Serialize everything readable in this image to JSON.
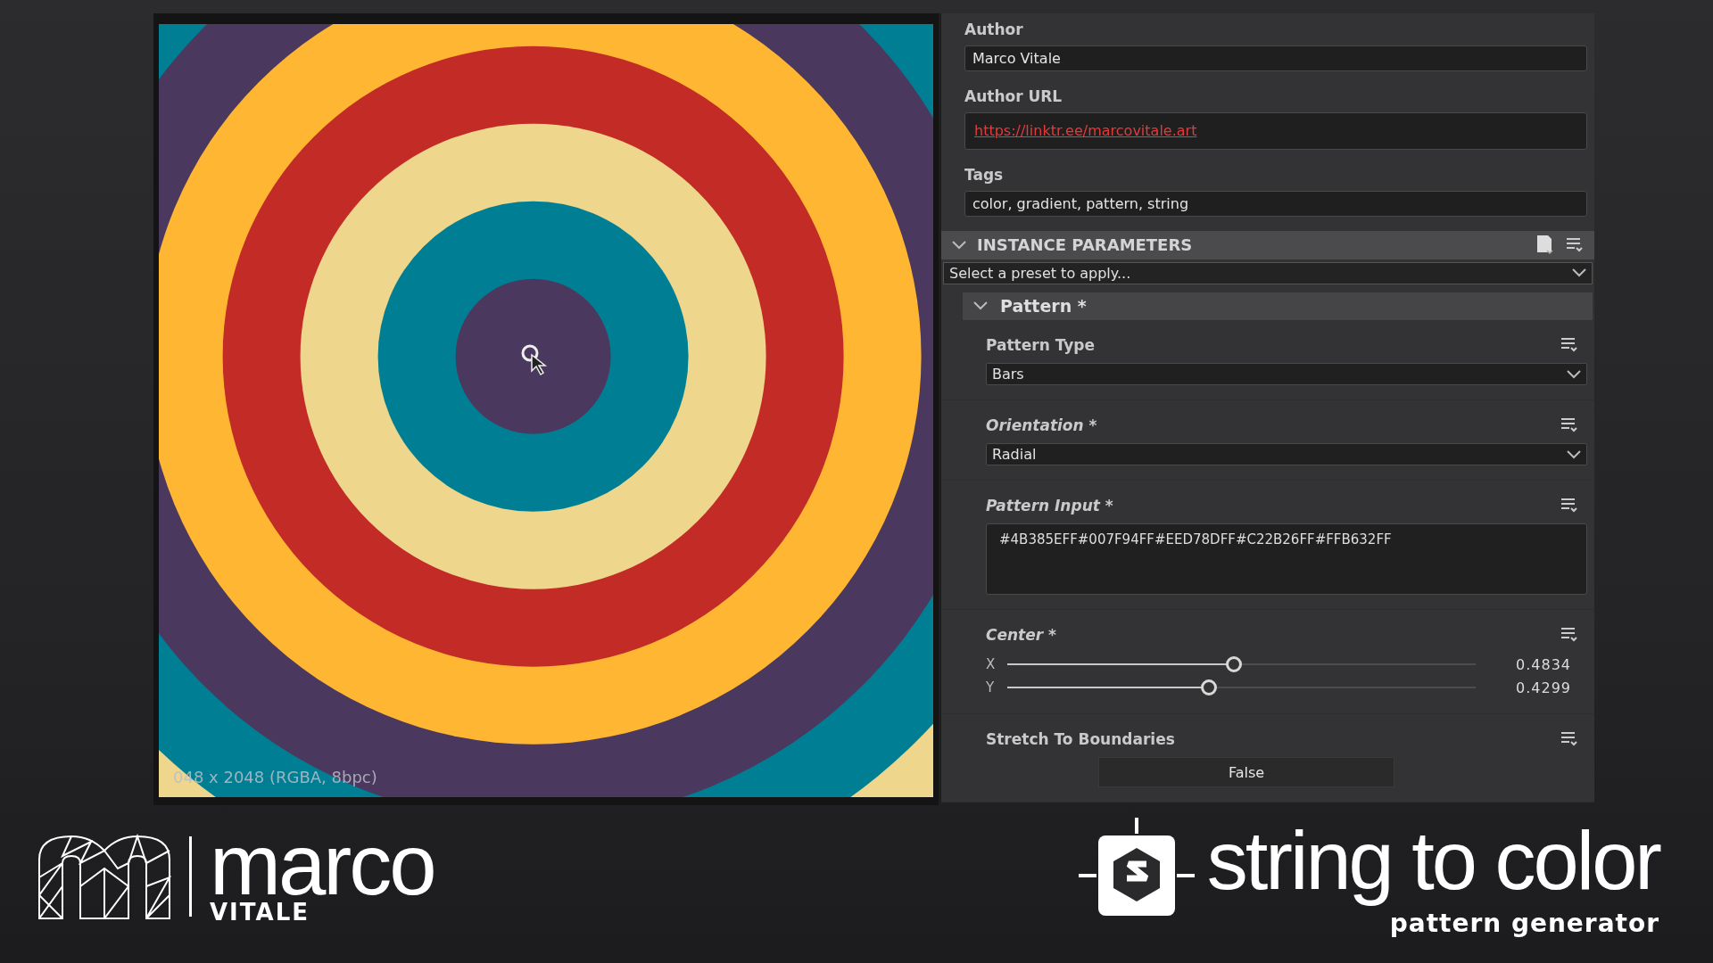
{
  "viewport": {
    "resolution_label": "048 x 2048 (RGBA, 8bpc)"
  },
  "properties": [
    {
      "kind": "text",
      "label": "Author",
      "value": "Marco Vitale"
    },
    {
      "kind": "link",
      "label": "Author URL",
      "value": "https://linktr.ee/marcovitale.art"
    },
    {
      "kind": "text",
      "label": "Tags",
      "value": "color, gradient, pattern, string"
    }
  ],
  "instance_parameters": {
    "title": "INSTANCE PARAMETERS",
    "expanded": true,
    "preset_placeholder": "Select a preset to apply...",
    "groups": [
      {
        "title": "Pattern *",
        "expanded": true,
        "parameters": [
          {
            "kind": "dropdown",
            "label": "Pattern Type",
            "modified": false,
            "value": "Bars"
          },
          {
            "kind": "dropdown",
            "label": "Orientation *",
            "modified": true,
            "value": "Radial"
          },
          {
            "kind": "textarea",
            "label": "Pattern Input *",
            "modified": true,
            "value": "#4B385EFF#007F94FF#EED78DFF#C22B26FF#FFB632FF"
          },
          {
            "kind": "vector",
            "label": "Center *",
            "modified": true,
            "components": [
              {
                "axis": "X",
                "level": 0.4834,
                "reading": "0.4834"
              },
              {
                "axis": "Y",
                "level": 0.4299,
                "reading": "0.4299"
              }
            ]
          },
          {
            "kind": "toggle",
            "label": "Stretch To Boundaries",
            "modified": false,
            "value": "False"
          }
        ]
      }
    ]
  },
  "branding": {
    "author_first": "marco",
    "author_last": "VITALE",
    "product": "string to color",
    "subtitle": "pattern generator"
  }
}
